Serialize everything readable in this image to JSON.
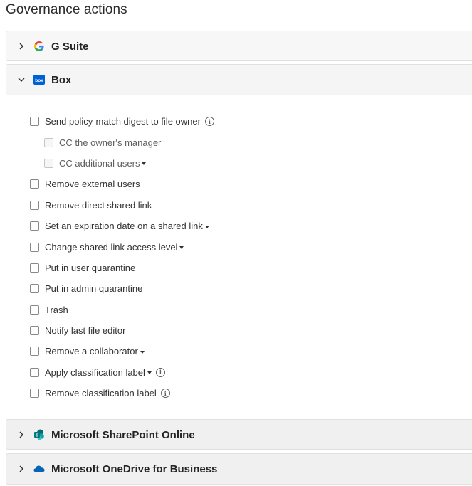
{
  "page": {
    "title": "Governance actions"
  },
  "sections": {
    "gsuite": {
      "title": "G Suite",
      "expanded": false,
      "icon": "google-g-icon"
    },
    "box": {
      "title": "Box",
      "expanded": true,
      "icon": "box-logo-icon",
      "logo_text": "box",
      "options": [
        {
          "label": "Send policy-match digest to file owner",
          "checked": false,
          "sub": false,
          "dropdown": false,
          "info": true
        },
        {
          "label": "CC the owner's manager",
          "checked": false,
          "sub": true,
          "dropdown": false,
          "info": false
        },
        {
          "label": "CC additional users",
          "checked": false,
          "sub": true,
          "dropdown": true,
          "info": false
        },
        {
          "label": "Remove external users",
          "checked": false,
          "sub": false,
          "dropdown": false,
          "info": false
        },
        {
          "label": "Remove direct shared link",
          "checked": false,
          "sub": false,
          "dropdown": false,
          "info": false
        },
        {
          "label": "Set an expiration date on a shared link",
          "checked": false,
          "sub": false,
          "dropdown": true,
          "info": false
        },
        {
          "label": "Change shared link access level",
          "checked": false,
          "sub": false,
          "dropdown": true,
          "info": false
        },
        {
          "label": "Put in user quarantine",
          "checked": false,
          "sub": false,
          "dropdown": false,
          "info": false
        },
        {
          "label": "Put in admin quarantine",
          "checked": false,
          "sub": false,
          "dropdown": false,
          "info": false
        },
        {
          "label": "Trash",
          "checked": false,
          "sub": false,
          "dropdown": false,
          "info": false
        },
        {
          "label": "Notify last file editor",
          "checked": false,
          "sub": false,
          "dropdown": false,
          "info": false
        },
        {
          "label": "Remove a collaborator",
          "checked": false,
          "sub": false,
          "dropdown": true,
          "info": false
        },
        {
          "label": "Apply classification label",
          "checked": false,
          "sub": false,
          "dropdown": true,
          "info": true
        },
        {
          "label": "Remove classification label",
          "checked": false,
          "sub": false,
          "dropdown": false,
          "info": true
        }
      ]
    },
    "sharepoint": {
      "title": "Microsoft SharePoint Online",
      "expanded": false,
      "icon": "sharepoint-icon"
    },
    "onedrive": {
      "title": "Microsoft OneDrive for Business",
      "expanded": false,
      "icon": "onedrive-cloud-icon"
    }
  },
  "icons": {
    "info_glyph": "i"
  },
  "colors": {
    "google_blue": "#4285F4",
    "google_red": "#EA4335",
    "google_yellow": "#FBBC05",
    "google_green": "#34A853",
    "box_blue": "#0061D5",
    "sharepoint_teal": "#038387",
    "onedrive_blue": "#0364B8"
  }
}
